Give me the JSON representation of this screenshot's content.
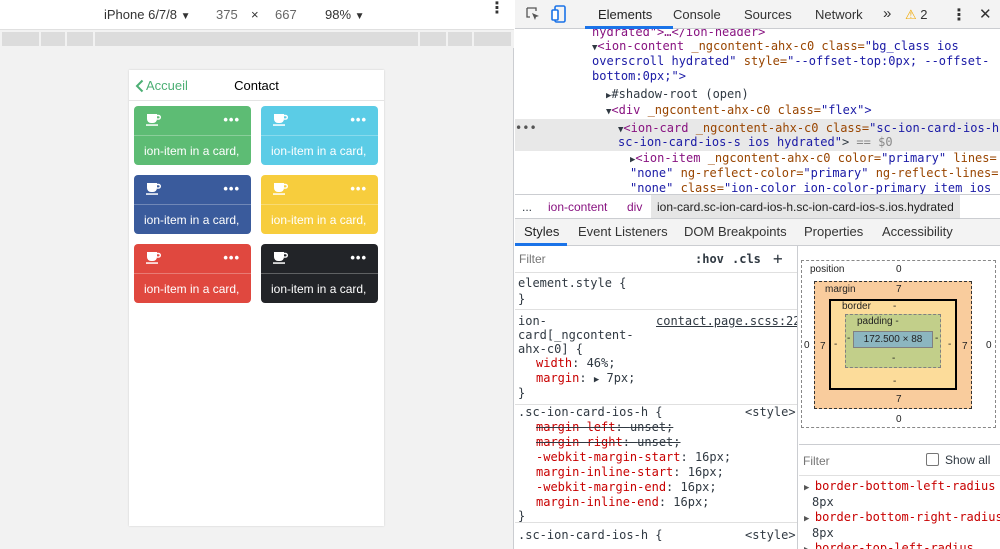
{
  "device_toolbar": {
    "device": "iPhone 6/7/8",
    "width": "375",
    "times": "×",
    "height": "667",
    "zoom": "98%"
  },
  "app": {
    "back_label": "Accueil",
    "title": "Contact",
    "more": "•••",
    "cards": [
      {
        "text": "ion-item in a card,",
        "color": "#5dbc74"
      },
      {
        "text": "ion-item in a card,",
        "color": "#5bcce6"
      },
      {
        "text": "ion-item in a card,",
        "color": "#3a5b9c"
      },
      {
        "text": "ion-item in a card,",
        "color": "#f7cd3d"
      },
      {
        "text": "ion-item in a card,",
        "color": "#e0483f"
      },
      {
        "text": "ion-item in a card,",
        "color": "#222428"
      }
    ]
  },
  "devtools": {
    "tabs": [
      "Elements",
      "Console",
      "Sources",
      "Network"
    ],
    "more_tabs": "»",
    "warnings": "2",
    "dom": {
      "l0": "hydrated\">…</ion-header>",
      "l1a": "<ion-content",
      "l1b": "_ngcontent-ahx-c0",
      "l1c": "class=",
      "l1d": "\"bg_class ios",
      "l2": "overscroll hydrated\"",
      "l2b": "style=",
      "l2c": "\"--offset-top:0px; --offset-",
      "l3": "bottom:0px;\">",
      "l4": "#shadow-root (open)",
      "l5a": "<div",
      "l5b": "_ngcontent-ahx-c0",
      "l5c": "class=",
      "l5d": "\"flex\">",
      "l6a": "<ion-card",
      "l6b": "_ngcontent-ahx-c0",
      "l6c": "class=",
      "l6d": "\"sc-ion-card-ios-h",
      "l7": "sc-ion-card-ios-s ios hydrated\"",
      "l7b": "== $0",
      "l8a": "<ion-item",
      "l8b": "_ngcontent-ahx-c0",
      "l8c": "color=",
      "l8d": "\"primary\"",
      "l8e": "lines=",
      "l9a": "\"none\"",
      "l9b": "ng-reflect-color=",
      "l9c": "\"primary\"",
      "l9d": "ng-reflect-lines=",
      "l10a": "\"none\"",
      "l10b": "class=",
      "l10c": "\"ion-color ion-color-primary item ios",
      "ellipsis": "•••"
    },
    "breadcrumbs": [
      "...",
      "ion-content",
      "div",
      "ion-card.sc-ion-card-ios-h.sc-ion-card-ios-s.ios.hydrated"
    ],
    "subtabs": [
      "Styles",
      "Event Listeners",
      "DOM Breakpoints",
      "Properties",
      "Accessibility"
    ],
    "styles": {
      "filter_placeholder": "Filter",
      "hov": ":hov",
      "cls": ".cls",
      "plus": "+",
      "element_style": "element.style {",
      "close": "}",
      "rule1_sel1": "ion-",
      "rule1_sel2": "card[_ngcontent-",
      "rule1_sel3": "ahx-c0] {",
      "rule1_src": "contact.page.scss:22",
      "rule1_p1": "width",
      "rule1_v1": "46%;",
      "rule1_p2": "margin",
      "rule1_v2": "7px;",
      "rule2_sel": ".sc-ion-card-ios-h {",
      "rule2_src": "<style>",
      "rule2_p1": "margin-left",
      "rule2_v1": "unset;",
      "rule2_p2": "margin-right",
      "rule2_v2": "unset;",
      "rule2_p3": "-webkit-margin-start",
      "rule2_v3": "16px;",
      "rule2_p4": "margin-inline-start",
      "rule2_v4": "16px;",
      "rule2_p5": "-webkit-margin-end",
      "rule2_v5": "16px;",
      "rule2_p6": "margin-inline-end",
      "rule2_v6": "16px;",
      "rule3_sel": ".sc-ion-card-ios-h {",
      "rule3_src": "<style>"
    },
    "box_model": {
      "position_label": "position",
      "position_top": "0",
      "position_bottom": "0",
      "position_left": "0",
      "position_right": "0",
      "margin_label": "margin",
      "margin_top": "7",
      "margin_bottom": "7",
      "margin_left": "7",
      "margin_right": "7",
      "border_label": "border",
      "border_top": "-",
      "border_bottom": "-",
      "border_left": "-",
      "border_right": "-",
      "padding_label": "padding -",
      "padding_bottom": "-",
      "padding_left": "-",
      "padding_right": "-",
      "content": "172.500 × 88"
    },
    "computed": {
      "filter_placeholder": "Filter",
      "show_all": "Show all",
      "items": [
        {
          "name": "border-bottom-left-radius",
          "value": "8px"
        },
        {
          "name": "border-bottom-right-radius",
          "value": "8px"
        },
        {
          "name": "border-top-left-radius",
          "value": ""
        }
      ]
    }
  }
}
